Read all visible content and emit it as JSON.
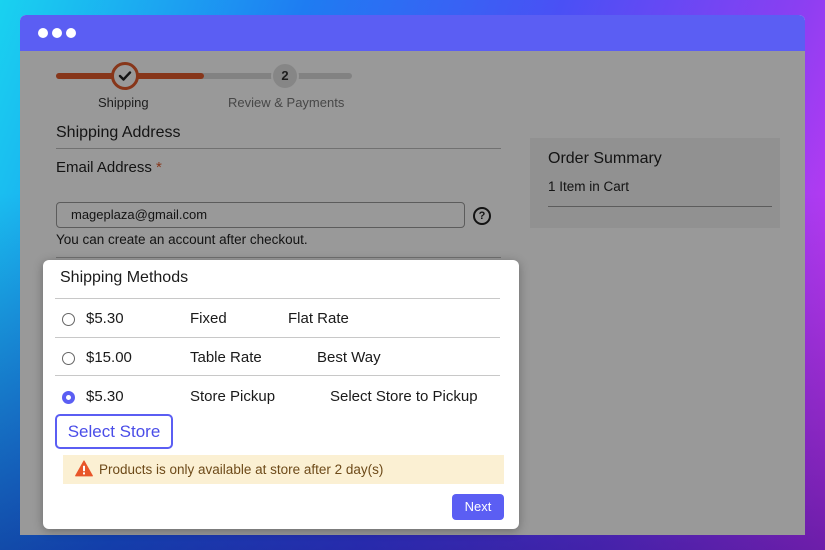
{
  "progress": {
    "steps": [
      {
        "label": "Shipping",
        "state": "complete",
        "icon": "check-icon"
      },
      {
        "label": "Review & Payments",
        "number": "2",
        "state": "upcoming"
      }
    ],
    "accent": "#e25a2c"
  },
  "shipping_address": {
    "title": "Shipping Address",
    "email_label": "Email Address",
    "required_mark": "*",
    "email_value": "mageplaza@gmail.com",
    "help_icon_text": "?",
    "note": "You can create an account after checkout."
  },
  "order_summary": {
    "title": "Order Summary",
    "items": "1 Item in Cart"
  },
  "shipping_methods": {
    "title": "Shipping Methods",
    "options": [
      {
        "price": "$5.30",
        "method": "Fixed",
        "carrier": "Flat Rate",
        "selected": false
      },
      {
        "price": "$15.00",
        "method": "Table Rate",
        "carrier": "Best Way",
        "selected": false
      },
      {
        "price": "$5.30",
        "method": "Store Pickup",
        "carrier": "Select Store to Pickup",
        "selected": true
      }
    ],
    "select_store_label": "Select Store",
    "warning": "Products is only available at store after 2 day(s)",
    "next_label": "Next"
  },
  "colors": {
    "primary": "#5b5ef3",
    "warning_bg": "#fbf0d3",
    "warning_icon": "#e8562a"
  }
}
